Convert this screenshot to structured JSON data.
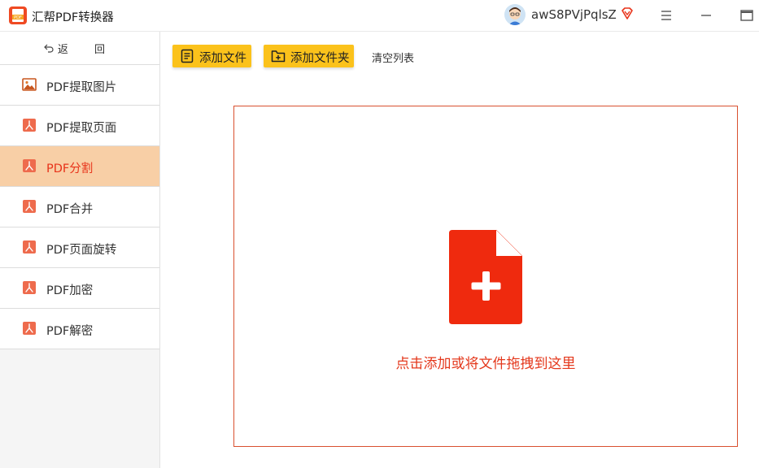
{
  "app": {
    "title": "汇帮PDF转换器"
  },
  "user": {
    "name": "awS8PVjPqlsZ"
  },
  "sidebar": {
    "back_label": "返 回",
    "items": [
      {
        "label": "PDF提取图片",
        "icon": "image-icon"
      },
      {
        "label": "PDF提取页面",
        "icon": "pdf-icon"
      },
      {
        "label": "PDF分割",
        "icon": "pdf-icon",
        "active": true
      },
      {
        "label": "PDF合并",
        "icon": "pdf-icon"
      },
      {
        "label": "PDF页面旋转",
        "icon": "pdf-icon"
      },
      {
        "label": "PDF加密",
        "icon": "pdf-icon"
      },
      {
        "label": "PDF解密",
        "icon": "pdf-icon"
      }
    ]
  },
  "toolbar": {
    "add_file_label": "添加文件",
    "add_folder_label": "添加文件夹",
    "clear_label": "清空列表"
  },
  "dropzone": {
    "hint": "点击添加或将文件拖拽到这里"
  },
  "colors": {
    "accent": "#fbc21b",
    "active_bg": "#f8cfa6",
    "active_text": "#e8331a",
    "brand_red": "#ef4a23"
  }
}
